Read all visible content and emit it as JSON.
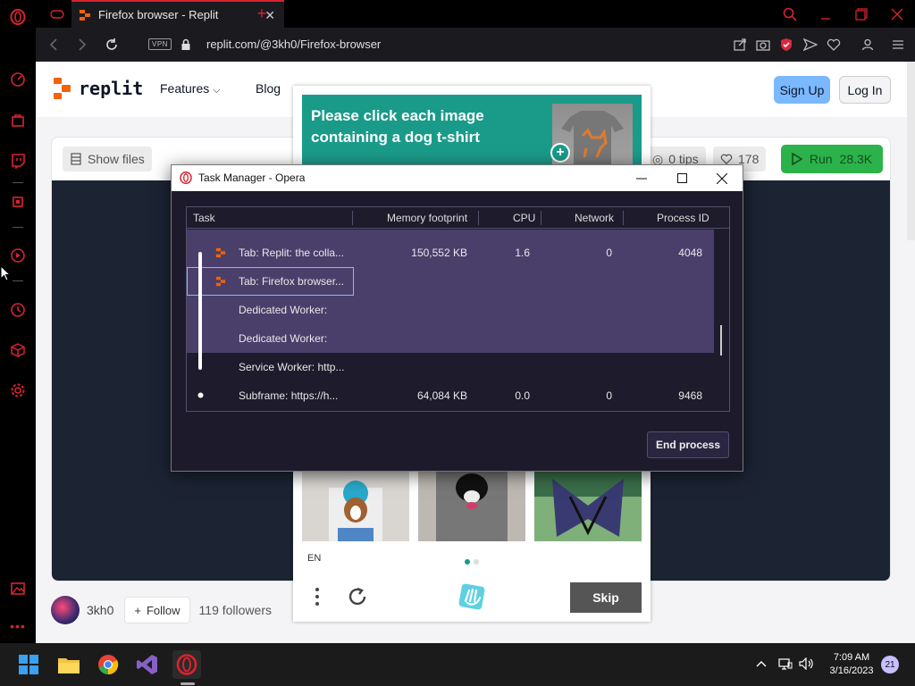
{
  "browser": {
    "tab_title": "Firefox browser - Replit",
    "url": "replit.com/@3kh0/Firefox-browser",
    "vpn_label": "VPN"
  },
  "replit": {
    "logo_text": "replit",
    "nav_features": "Features",
    "nav_blog": "Blog",
    "signup": "Sign Up",
    "login": "Log In",
    "show_files": "Show files",
    "tips": "0 tips",
    "likes": "178",
    "run_label": "Run",
    "run_count": "28.3K",
    "author": "3kh0",
    "follow": "Follow",
    "followers": "119 followers"
  },
  "captcha": {
    "prompt": "Please click each image containing a dog t-shirt",
    "lang": "EN",
    "skip": "Skip"
  },
  "task_manager": {
    "title": "Task Manager - Opera",
    "columns": [
      "Task",
      "Memory footprint",
      "CPU",
      "Network",
      "Process ID"
    ],
    "rows": [
      {
        "task": "Tab: Replit: the colla...",
        "memory": "150,552 KB",
        "cpu": "1.6",
        "network": "0",
        "pid": "4048"
      },
      {
        "task": "Tab: Firefox browser...",
        "memory": "",
        "cpu": "",
        "network": "",
        "pid": ""
      },
      {
        "task": "Dedicated Worker:",
        "memory": "",
        "cpu": "",
        "network": "",
        "pid": ""
      },
      {
        "task": "Dedicated Worker:",
        "memory": "",
        "cpu": "",
        "network": "",
        "pid": ""
      },
      {
        "task": "Service Worker: http...",
        "memory": "",
        "cpu": "",
        "network": "",
        "pid": ""
      },
      {
        "task": "Subframe: https://h...",
        "memory": "64,084 KB",
        "cpu": "0.0",
        "network": "0",
        "pid": "9468"
      }
    ],
    "end_process": "End process"
  },
  "taskbar": {
    "time": "7:09 AM",
    "date": "3/16/2023",
    "notifications": "21"
  },
  "colors": {
    "opera_red": "#d8232f",
    "replit_orange": "#f26207",
    "captcha_teal": "#1a9b8a",
    "tm_highlight": "#4a3f6b"
  }
}
